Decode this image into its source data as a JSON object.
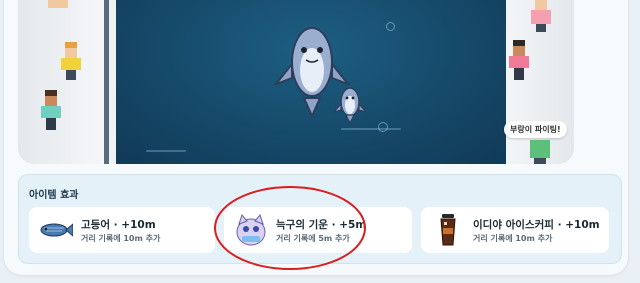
{
  "scene": {
    "speech_bubble": "부랑이 파이팅!",
    "colors": {
      "water": "#16496a",
      "rail": "#5b6b7a"
    }
  },
  "item_effects": {
    "title": "아이템 효과",
    "items": [
      {
        "icon": "mackerel-fish-icon",
        "title": "고등어 · +10m",
        "desc": "거리 기록에 10m 추가"
      },
      {
        "icon": "cat-character-icon",
        "title": "늑구의 기운 · +5m",
        "desc": "거리 기록에 5m 추가"
      },
      {
        "icon": "iced-coffee-icon",
        "title": "이디야 아이스커피 · +10m",
        "desc": "거리 기록에 10m 추가"
      }
    ]
  },
  "annotation": {
    "color": "#d81e1e",
    "shape": "ellipse"
  }
}
